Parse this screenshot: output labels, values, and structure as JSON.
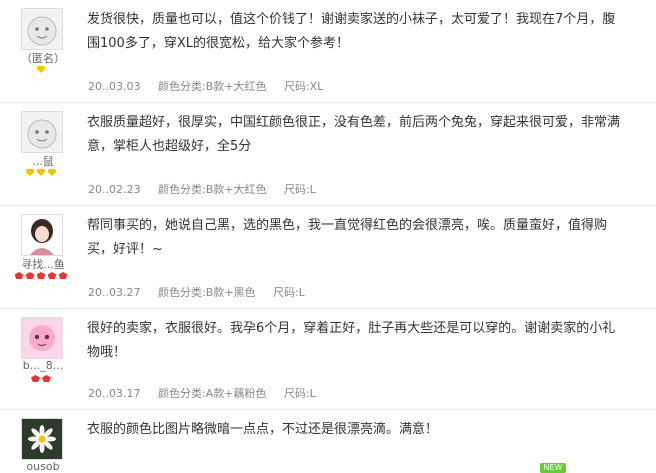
{
  "reviews": [
    {
      "user": "（匿名）",
      "rank": "y1",
      "lines": [
        "发货很快，质量也可以，值这个价钱了！谢谢卖家送的小袜子，太可爱了！我现在7个月，腹",
        "围100多了，穿XL的很宽松，给大家个参考！"
      ],
      "date": "20..03.03",
      "color": "颜色分类:B款+大红色",
      "size": "尺码:XL"
    },
    {
      "user": "...鼠",
      "rank": "y3",
      "lines": [
        "衣服质量超好，很厚实，中国红颜色很正，没有色差，前后两个兔兔，穿起来很可爱，非常满",
        "意，掌柜人也超级好，全5分"
      ],
      "date": "20..02.23",
      "color": "颜色分类:B款+大红色",
      "size": "尺码:L"
    },
    {
      "user": "寻找...鱼",
      "rank": "r5",
      "lines": [
        "帮同事买的，她说自己黑，选的黑色，我一直觉得红色的会很漂亮，唉。质量蛮好，值得购",
        "买，好评！~"
      ],
      "date": "20..03.27",
      "color": "颜色分类:B款+黑色",
      "size": "尺码:L"
    },
    {
      "user": "b..._8...",
      "rank": "r2",
      "lines": [
        "很好的卖家，衣服很好。我孕6个月，穿着正好，肚子再大些还是可以穿的。谢谢卖家的小礼",
        "物哦！"
      ],
      "date": "20..03.17",
      "color": "颜色分类:A款+藕粉色",
      "size": "尺码:L"
    },
    {
      "user": "ousob",
      "rank": "",
      "lines": [
        "衣服的颜色比图片略微暗一点点，不过还是很漂亮滴。满意！"
      ],
      "date": "",
      "color": "",
      "size": ""
    }
  ],
  "badge": "NEW"
}
